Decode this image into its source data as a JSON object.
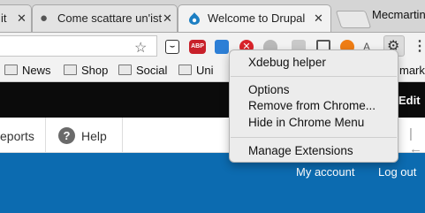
{
  "tabs": [
    {
      "title": "it",
      "active": false
    },
    {
      "title": "Come scattare un'ist",
      "active": false
    },
    {
      "title": "Welcome to Drupal",
      "active": true
    }
  ],
  "profile_name": "Mecmartini",
  "bookmarks": [
    "News",
    "Shop",
    "Social",
    "Uni",
    "marks"
  ],
  "toolbar_extensions": [
    "ghostery",
    "abp",
    "blue",
    "red-x",
    "drupal",
    "gray",
    "cast",
    "orange",
    "translate",
    "xdebug-gear"
  ],
  "menu": {
    "title": "Xdebug helper",
    "options": "Options",
    "remove": "Remove from Chrome...",
    "hide": "Hide in Chrome Menu",
    "manage": "Manage Extensions"
  },
  "page": {
    "edit": "Edit",
    "reports": "eports",
    "help": "Help",
    "my_account": "My account",
    "log_out": "Log out"
  },
  "colors": {
    "drupal_blue": "#0c6bb0",
    "admin_bar": "#0b0b0b",
    "menu_bg": "#ececec"
  }
}
